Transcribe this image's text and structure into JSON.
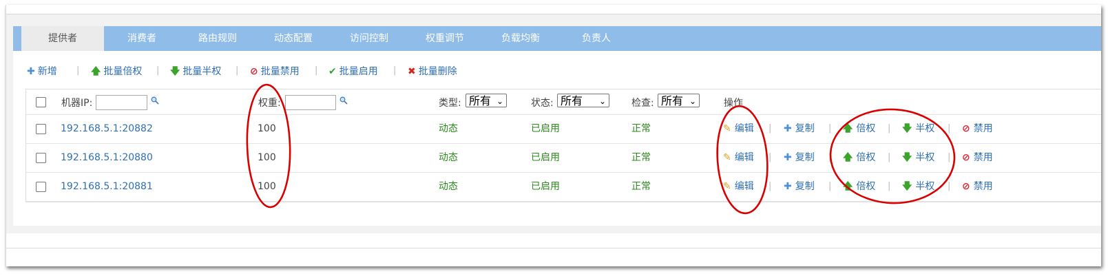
{
  "tabs": [
    {
      "label": "提供者",
      "active": true
    },
    {
      "label": "消费者"
    },
    {
      "label": "路由规则"
    },
    {
      "label": "动态配置"
    },
    {
      "label": "访问控制"
    },
    {
      "label": "权重调节"
    },
    {
      "label": "负载均衡"
    },
    {
      "label": "负责人"
    }
  ],
  "toolbar": {
    "add": "新增",
    "batch_double": "批量倍权",
    "batch_half": "批量半权",
    "batch_disable": "批量禁用",
    "batch_enable": "批量启用",
    "batch_delete": "批量删除",
    "separator": "|"
  },
  "header": {
    "ip_label": "机器IP:",
    "weight_label": "权重:",
    "type_label": "类型:",
    "type_value": "所有",
    "status_label": "状态:",
    "status_value": "所有",
    "check_label": "检查:",
    "check_value": "所有",
    "actions_label": "操作"
  },
  "actions": {
    "edit": "编辑",
    "copy": "复制",
    "double": "倍权",
    "half": "半权",
    "disable": "禁用"
  },
  "rows": [
    {
      "ip": "192.168.5.1:20882",
      "weight": "100",
      "type": "动态",
      "status": "已启用",
      "check": "正常"
    },
    {
      "ip": "192.168.5.1:20880",
      "weight": "100",
      "type": "动态",
      "status": "已启用",
      "check": "正常"
    },
    {
      "ip": "192.168.5.1:20881",
      "weight": "100",
      "type": "动态",
      "status": "已启用",
      "check": "正常"
    }
  ],
  "icons": {
    "add": "plus-icon",
    "double": "arrow-up-icon",
    "half": "arrow-down-icon",
    "disable": "ban-icon",
    "enable": "check-icon",
    "delete": "x-icon",
    "edit": "pencil-icon",
    "copy": "plus-icon",
    "search": "magnifier-icon"
  },
  "colors": {
    "tab_bar": "#8fbce8",
    "link": "#2f6fb3",
    "ok_text": "#2a8a1a",
    "annotation": "#d90000"
  }
}
